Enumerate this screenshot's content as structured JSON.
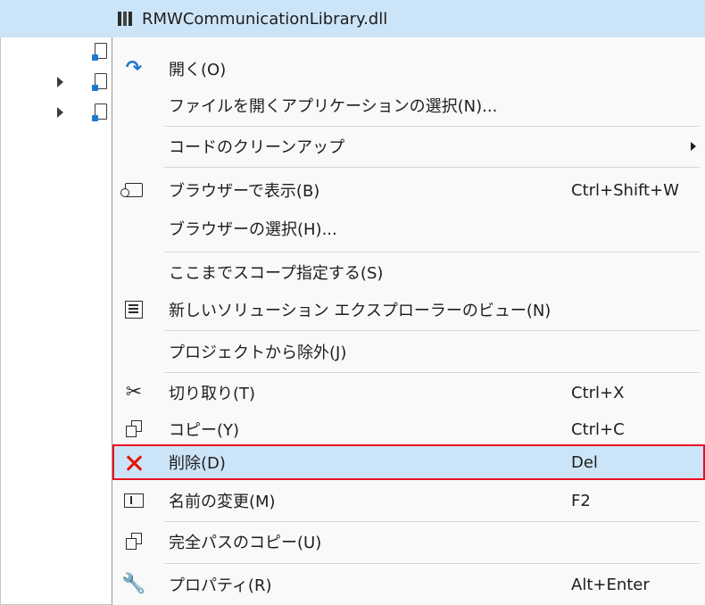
{
  "solution_explorer": {
    "selected_item": "RMWCommunicationLibrary.dll",
    "icon": "dll-library-icon"
  },
  "context_menu": {
    "items": [
      {
        "label": "開く(O)",
        "icon": "open-arrow-icon",
        "shortcut": ""
      },
      {
        "label": "ファイルを開くアプリケーションの選択(N)...",
        "icon": "",
        "shortcut": ""
      },
      {
        "label": "コードのクリーンアップ",
        "icon": "",
        "shortcut": "",
        "submenu": true
      },
      {
        "label": "ブラウザーで表示(B)",
        "icon": "browser-icon",
        "shortcut": "Ctrl+Shift+W"
      },
      {
        "label": "ブラウザーの選択(H)...",
        "icon": "",
        "shortcut": ""
      },
      {
        "label": "ここまでスコープ指定する(S)",
        "icon": "",
        "shortcut": ""
      },
      {
        "label": "新しいソリューション エクスプローラーのビュー(N)",
        "icon": "solution-explorer-icon",
        "shortcut": ""
      },
      {
        "label": "プロジェクトから除外(J)",
        "icon": "",
        "shortcut": ""
      },
      {
        "label": "切り取り(T)",
        "icon": "cut-icon",
        "shortcut": "Ctrl+X"
      },
      {
        "label": "コピー(Y)",
        "icon": "copy-icon",
        "shortcut": "Ctrl+C"
      },
      {
        "label": "削除(D)",
        "icon": "delete-x-icon",
        "shortcut": "Del",
        "highlighted": true
      },
      {
        "label": "名前の変更(M)",
        "icon": "rename-icon",
        "shortcut": "F2"
      },
      {
        "label": "完全パスのコピー(U)",
        "icon": "copy-icon",
        "shortcut": ""
      },
      {
        "label": "プロパティ(R)",
        "icon": "wrench-icon",
        "shortcut": "Alt+Enter"
      }
    ]
  },
  "colors": {
    "selection": "#cce4f7",
    "highlight_outline": "#e81123",
    "delete_icon": "#e51400",
    "menu_background": "#f9f9f9"
  }
}
